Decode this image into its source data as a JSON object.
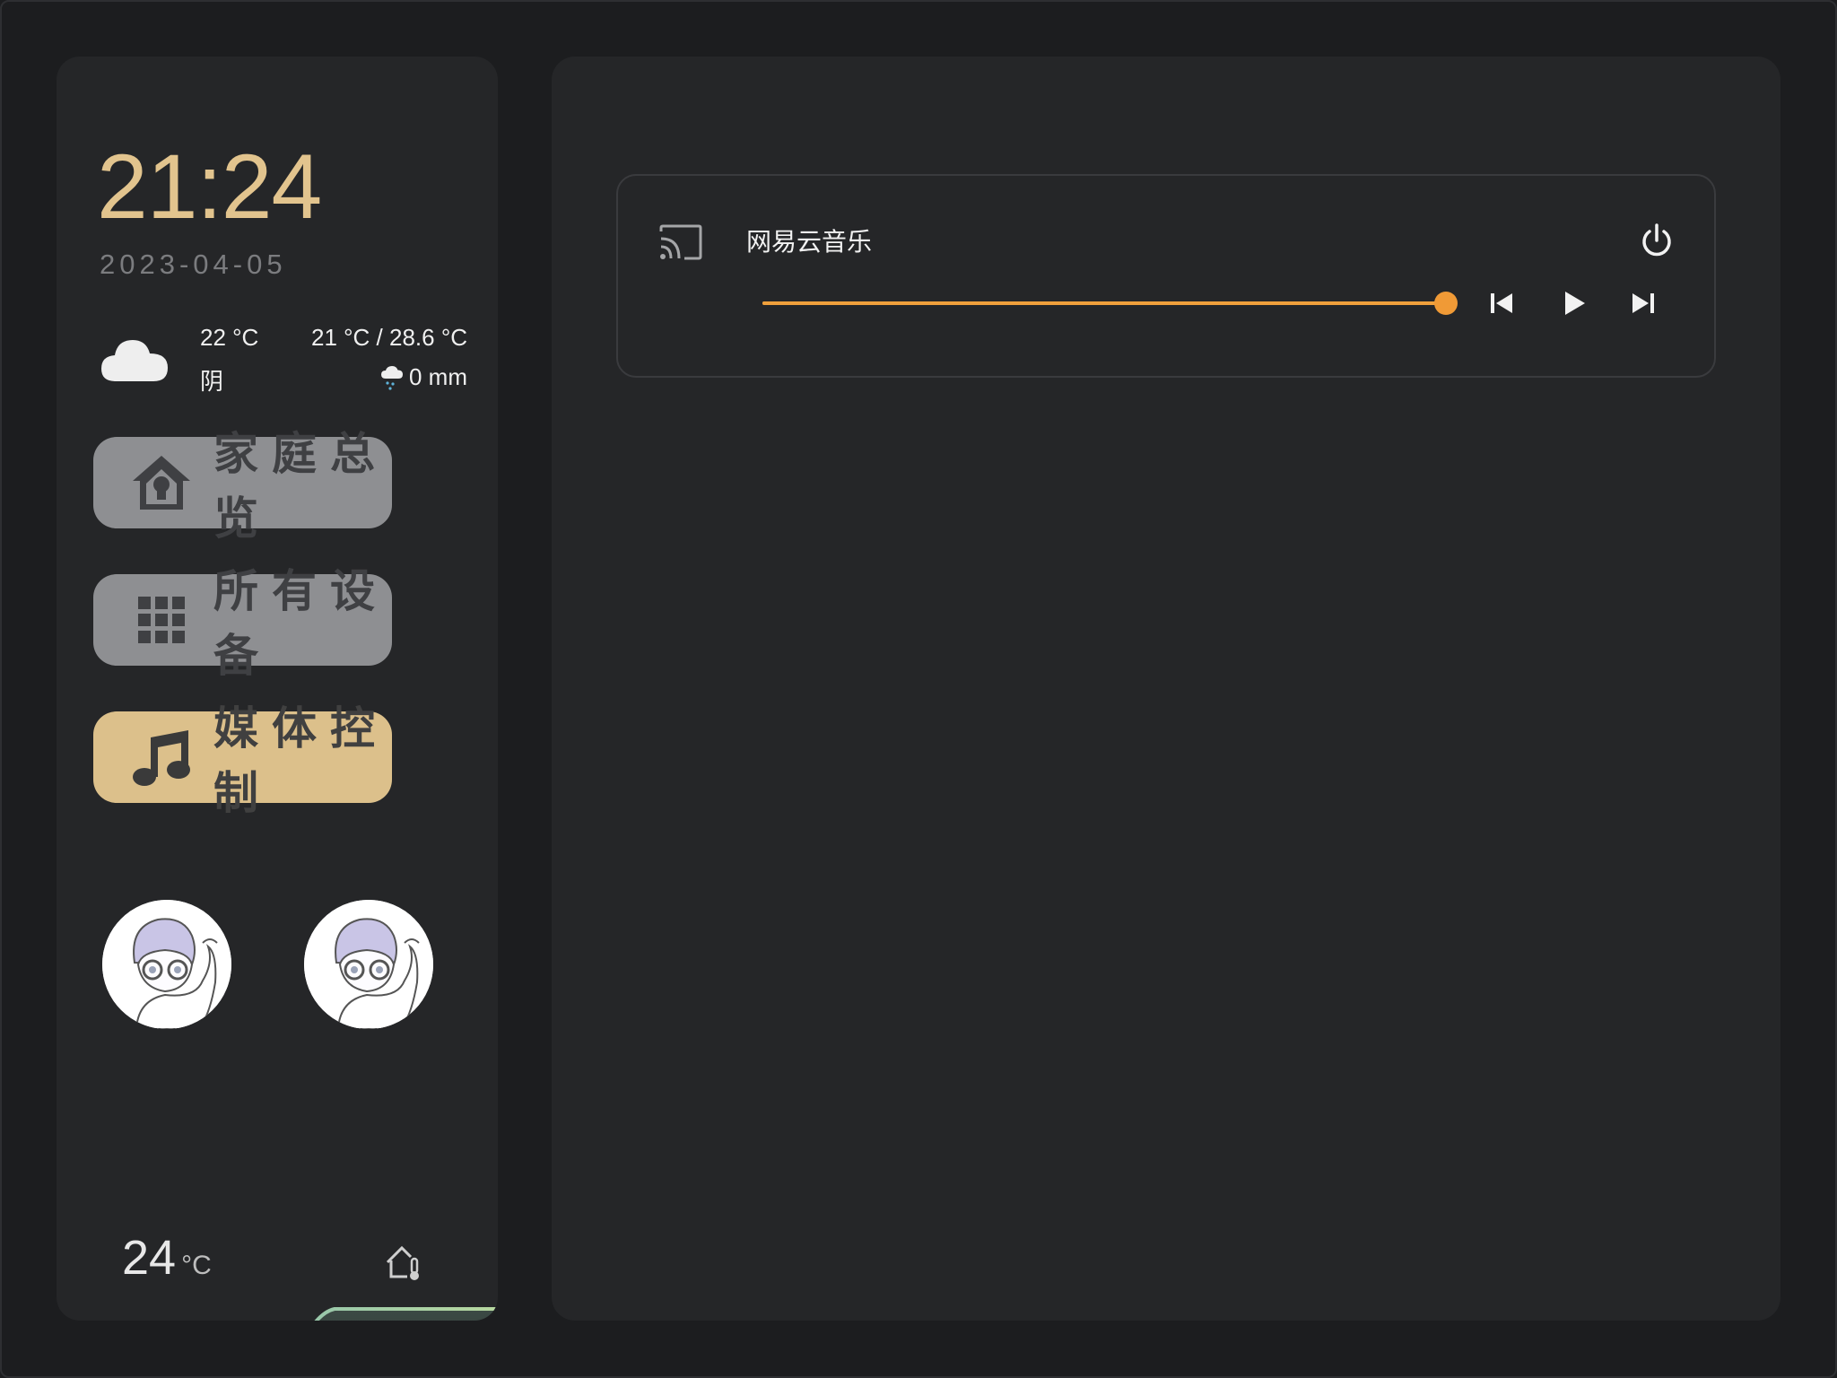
{
  "clock": {
    "time": "21:24",
    "date": "2023-04-05"
  },
  "weather": {
    "icon": "cloud-icon",
    "temperature": "22 °C",
    "range": "21 °C / 28.6 °C",
    "condition": "阴",
    "precipitation": "0 mm"
  },
  "nav": {
    "home_label": "家庭总览",
    "all_devices_label": "所有设备",
    "media_label": "媒体控制",
    "active": "媒体控制"
  },
  "room": {
    "temperature": "24",
    "unit": "°C",
    "icon": "home-thermometer-icon"
  },
  "player": {
    "name": "网易云音乐",
    "volume_fraction": 1.0,
    "accent_color": "#f0a03c",
    "controls": [
      "previous-track-icon",
      "play-icon",
      "next-track-icon"
    ]
  },
  "colors": {
    "background": "#1c1d1f",
    "panel": "#252628",
    "clock": "#e2c48e",
    "nav_inactive": "#8e8f92",
    "nav_active": "#dcc08b"
  }
}
